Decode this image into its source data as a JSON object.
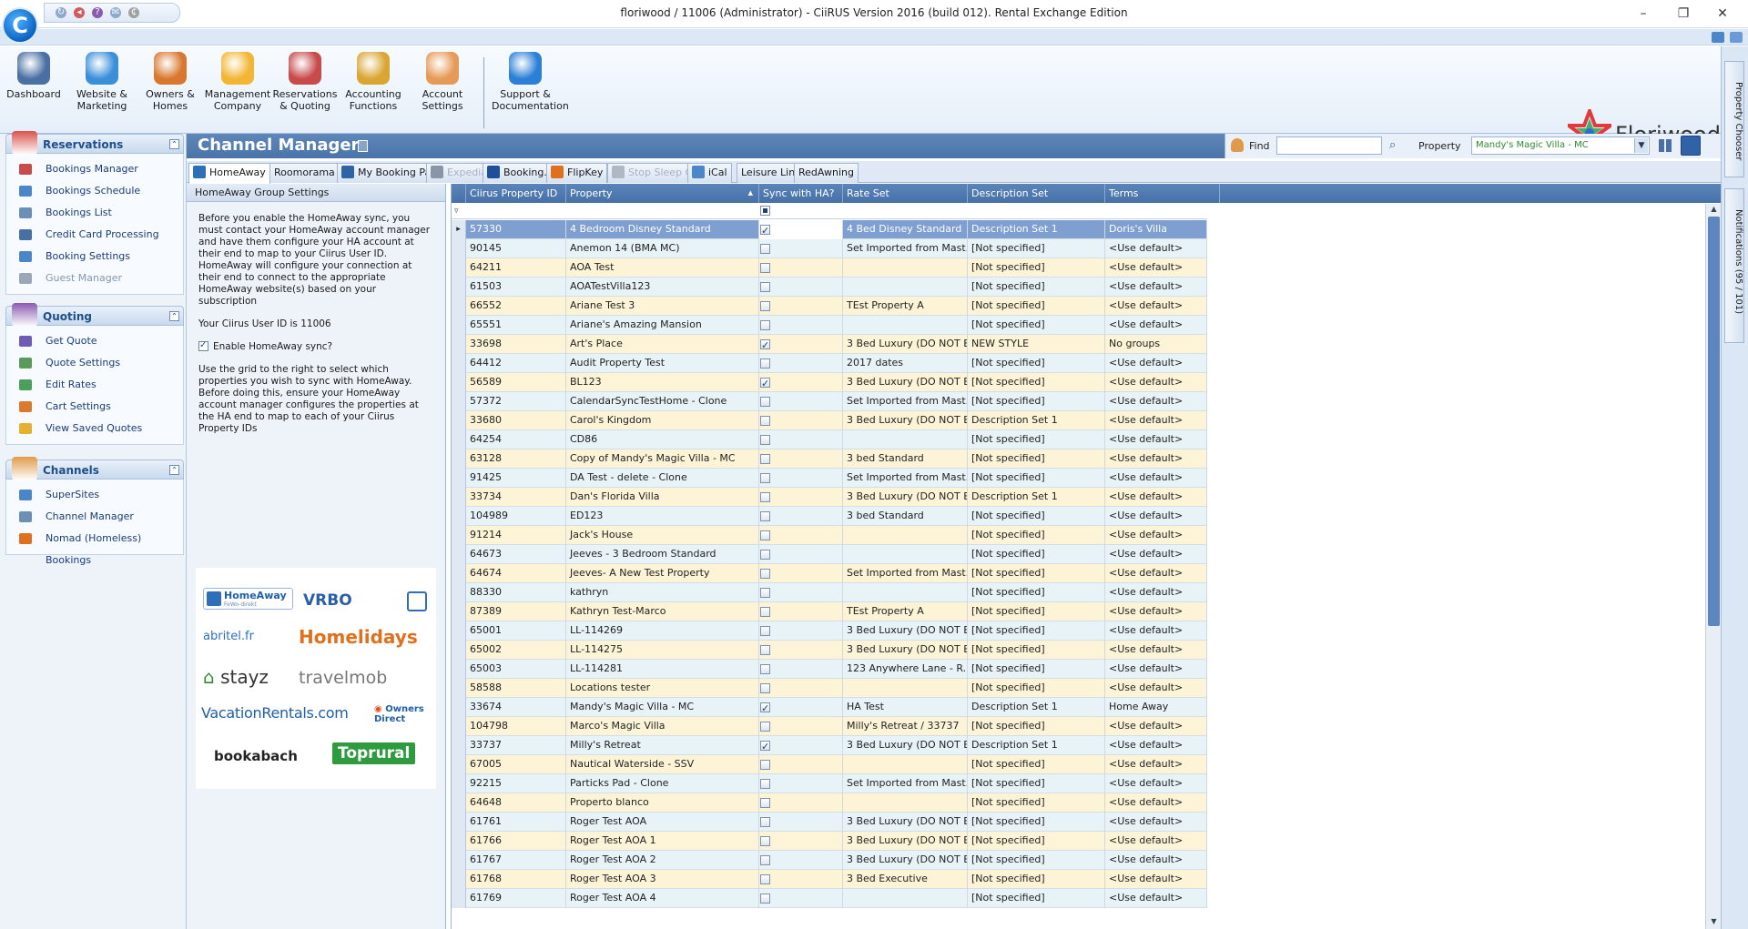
{
  "window": {
    "title": "floriwood / 11006 (Administrator) - CiiRUS Version 2016 (build 012). Rental Exchange Edition",
    "min_symbol": "–",
    "max_symbol": "❐",
    "close_symbol": "✕",
    "orb_letter": "C"
  },
  "ribbon": {
    "buttons": [
      {
        "label": "Dashboard",
        "icon": "gauge-icon",
        "color": "#4a6fa3"
      },
      {
        "label": "Website & Marketing",
        "icon": "globe-icon",
        "color": "#3b8fd9"
      },
      {
        "label": "Owners & Homes",
        "icon": "house-icon",
        "color": "#d9772e"
      },
      {
        "label": "Management Company",
        "icon": "puzzle-icon",
        "color": "#f2b634"
      },
      {
        "label": "Reservations & Quoting",
        "icon": "calendar-icon",
        "color": "#c84a4a"
      },
      {
        "label": "Accounting Functions",
        "icon": "coins-icon",
        "color": "#d9a634"
      },
      {
        "label": "Account Settings",
        "icon": "users-icon",
        "color": "#e59a57"
      },
      {
        "label": "Support & Documentation",
        "icon": "help-icon",
        "color": "#2a7fd6"
      }
    ],
    "logo_text": "Floriwood"
  },
  "nav": {
    "groups": [
      {
        "title": "Reservations",
        "items": [
          {
            "label": "Bookings Manager",
            "disabled": false
          },
          {
            "label": "Bookings Schedule",
            "disabled": false
          },
          {
            "label": "Bookings List",
            "disabled": false
          },
          {
            "label": "Credit Card Processing",
            "disabled": false
          },
          {
            "label": "Booking Settings",
            "disabled": false
          },
          {
            "label": "Guest Manager",
            "disabled": true
          }
        ]
      },
      {
        "title": "Quoting",
        "items": [
          {
            "label": "Get Quote",
            "disabled": false
          },
          {
            "label": "Quote Settings",
            "disabled": false
          },
          {
            "label": "Edit Rates",
            "disabled": false
          },
          {
            "label": "Cart Settings",
            "disabled": false
          },
          {
            "label": "View Saved Quotes",
            "disabled": false
          }
        ]
      },
      {
        "title": "Channels",
        "items": [
          {
            "label": "SuperSites",
            "disabled": false
          },
          {
            "label": "Channel Manager",
            "disabled": false
          },
          {
            "label": "Nomad (Homeless) Bookings",
            "disabled": false
          }
        ]
      }
    ]
  },
  "header": {
    "title": "Channel Manager",
    "find_label": "Find",
    "find_value": "",
    "property_label": "Property",
    "property_value": "Mandy's Magic Villa - MC"
  },
  "tabs": [
    {
      "label": "HomeAway",
      "active": true,
      "disabled": false
    },
    {
      "label": "Roomorama",
      "active": false,
      "disabled": false
    },
    {
      "label": "My Booking Pal",
      "active": false,
      "disabled": false
    },
    {
      "label": "Expedia",
      "active": false,
      "disabled": true
    },
    {
      "label": "Booking.com",
      "active": false,
      "disabled": false
    },
    {
      "label": "FlipKey",
      "active": false,
      "disabled": false
    },
    {
      "label": "Stop Sleep Go",
      "active": false,
      "disabled": true
    },
    {
      "label": "iCal",
      "active": false,
      "disabled": false
    },
    {
      "label": "Leisure Link",
      "active": false,
      "disabled": false
    },
    {
      "label": "RedAwning",
      "active": false,
      "disabled": false
    }
  ],
  "settings": {
    "header": "HomeAway Group Settings",
    "intro": "Before you enable the HomeAway sync, you must contact your HomeAway account manager and have them configure your HA account at their end to map to your Ciirus User ID. HomeAway will configure your connection at their end to connect to the appropriate HomeAway website(s) based on your subscription",
    "user_id_text": "Your Ciirus User ID is 11006",
    "enable_label": "Enable HomeAway sync?",
    "enable_checked": true,
    "instructions": "Use the grid to the right to select which properties you wish to sync with HomeAway. Before doing this, ensure your HomeAway account manager configures the properties at the HA end to map to each of your Ciirus Property IDs",
    "logos": {
      "homeaway": "HomeAway",
      "homeaway_sub": "FeWo-direkt",
      "vrbo": "VRBO",
      "abritel": "abritel.fr",
      "homelidays": "Homelidays",
      "stayz": "stayz",
      "travelmob": "travelmob",
      "vacationrentals": "VacationRentals.com",
      "ownersdirect": "Owners Direct",
      "bookabach": "bookabach",
      "toprural": "Toprural"
    }
  },
  "grid": {
    "columns": [
      "Ciirus Property ID",
      "Property",
      "Sync with HA?",
      "Rate Set",
      "Description Set",
      "Terms"
    ],
    "rows": [
      {
        "id": "57330",
        "property": "4 Bedroom Disney Standard",
        "sync": true,
        "rate": "4 Bed Disney Standard",
        "desc": "Description Set 1",
        "terms": "Doris's Villa",
        "selected": true
      },
      {
        "id": "90145",
        "property": "Anemon 14 (BMA MC)",
        "sync": false,
        "rate": "Set Imported from Mast...",
        "desc": "[Not specified]",
        "terms": "<Use default>"
      },
      {
        "id": "64211",
        "property": "AOA Test",
        "sync": false,
        "rate": "",
        "desc": "[Not specified]",
        "terms": "<Use default>"
      },
      {
        "id": "61503",
        "property": "AOATestVilla123",
        "sync": false,
        "rate": "",
        "desc": "[Not specified]",
        "terms": "<Use default>"
      },
      {
        "id": "66552",
        "property": "Ariane Test 3",
        "sync": false,
        "rate": "TEst Property A",
        "desc": "[Not specified]",
        "terms": "<Use default>"
      },
      {
        "id": "65551",
        "property": "Ariane's Amazing Mansion",
        "sync": false,
        "rate": "",
        "desc": "[Not specified]",
        "terms": "<Use default>"
      },
      {
        "id": "33698",
        "property": "Art's Place",
        "sync": true,
        "rate": "3 Bed Luxury (DO NOT E...",
        "desc": "NEW STYLE",
        "terms": "No groups"
      },
      {
        "id": "64412",
        "property": "Audit Property Test",
        "sync": false,
        "rate": "2017 dates",
        "desc": "[Not specified]",
        "terms": "<Use default>"
      },
      {
        "id": "56589",
        "property": "BL123",
        "sync": true,
        "rate": "3 Bed Luxury (DO NOT E...",
        "desc": "[Not specified]",
        "terms": "<Use default>"
      },
      {
        "id": "57372",
        "property": "CalendarSyncTestHome - Clone",
        "sync": false,
        "rate": "Set Imported from Mast...",
        "desc": "[Not specified]",
        "terms": "<Use default>"
      },
      {
        "id": "33680",
        "property": "Carol's Kingdom",
        "sync": false,
        "rate": "3 Bed Luxury (DO NOT E...",
        "desc": "Description Set 1",
        "terms": "<Use default>"
      },
      {
        "id": "64254",
        "property": "CD86",
        "sync": false,
        "rate": "",
        "desc": "[Not specified]",
        "terms": "<Use default>"
      },
      {
        "id": "63128",
        "property": "Copy of Mandy's Magic Villa - MC",
        "sync": false,
        "rate": "3 bed Standard",
        "desc": "[Not specified]",
        "terms": "<Use default>"
      },
      {
        "id": "91425",
        "property": "DA Test - delete - Clone",
        "sync": false,
        "rate": "Set Imported from Mast...",
        "desc": "[Not specified]",
        "terms": "<Use default>"
      },
      {
        "id": "33734",
        "property": "Dan's Florida Villa",
        "sync": false,
        "rate": "3 Bed Luxury (DO NOT E...",
        "desc": "Description Set 1",
        "terms": "<Use default>"
      },
      {
        "id": "104989",
        "property": "ED123",
        "sync": false,
        "rate": "3 bed Standard",
        "desc": "[Not specified]",
        "terms": "<Use default>"
      },
      {
        "id": "91214",
        "property": "Jack's House",
        "sync": false,
        "rate": "",
        "desc": "[Not specified]",
        "terms": "<Use default>"
      },
      {
        "id": "64673",
        "property": "Jeeves - 3 Bedroom Standard",
        "sync": false,
        "rate": "",
        "desc": "[Not specified]",
        "terms": "<Use default>"
      },
      {
        "id": "64674",
        "property": "Jeeves- A New Test Property",
        "sync": false,
        "rate": "Set Imported from Mast...",
        "desc": "[Not specified]",
        "terms": "<Use default>"
      },
      {
        "id": "88330",
        "property": "kathryn",
        "sync": false,
        "rate": "",
        "desc": "[Not specified]",
        "terms": "<Use default>"
      },
      {
        "id": "87389",
        "property": "Kathryn Test-Marco",
        "sync": false,
        "rate": "TEst Property A",
        "desc": "[Not specified]",
        "terms": "<Use default>"
      },
      {
        "id": "65001",
        "property": "LL-114269",
        "sync": false,
        "rate": "3 Bed Luxury (DO NOT E...",
        "desc": "[Not specified]",
        "terms": "<Use default>"
      },
      {
        "id": "65002",
        "property": "LL-114275",
        "sync": false,
        "rate": "3 Bed Luxury (DO NOT E...",
        "desc": "[Not specified]",
        "terms": "<Use default>"
      },
      {
        "id": "65003",
        "property": "LL-114281",
        "sync": false,
        "rate": "123 Anywhere Lane - R...",
        "desc": "[Not specified]",
        "terms": "<Use default>"
      },
      {
        "id": "58588",
        "property": "Locations tester",
        "sync": false,
        "rate": "",
        "desc": "[Not specified]",
        "terms": "<Use default>"
      },
      {
        "id": "33674",
        "property": "Mandy's Magic Villa - MC",
        "sync": true,
        "rate": "HA Test",
        "desc": "Description Set 1",
        "terms": "Home Away"
      },
      {
        "id": "104798",
        "property": "Marco's Magic Villa",
        "sync": false,
        "rate": "Milly's Retreat / 33737",
        "desc": "[Not specified]",
        "terms": "<Use default>"
      },
      {
        "id": "33737",
        "property": "Milly's Retreat",
        "sync": true,
        "rate": "3 Bed Luxury (DO NOT E...",
        "desc": "Description Set 1",
        "terms": "<Use default>"
      },
      {
        "id": "67005",
        "property": "Nautical Waterside - SSV",
        "sync": false,
        "rate": "",
        "desc": "[Not specified]",
        "terms": "<Use default>"
      },
      {
        "id": "92215",
        "property": "Particks Pad - Clone",
        "sync": false,
        "rate": "Set Imported from Mast...",
        "desc": "[Not specified]",
        "terms": "<Use default>"
      },
      {
        "id": "64648",
        "property": "Properto blanco",
        "sync": false,
        "rate": "",
        "desc": "[Not specified]",
        "terms": "<Use default>"
      },
      {
        "id": "61761",
        "property": "Roger Test AOA",
        "sync": false,
        "rate": "3 Bed Luxury (DO NOT E...",
        "desc": "[Not specified]",
        "terms": "<Use default>"
      },
      {
        "id": "61766",
        "property": "Roger Test AOA 1",
        "sync": false,
        "rate": "3 Bed Luxury (DO NOT E...",
        "desc": "[Not specified]",
        "terms": "<Use default>"
      },
      {
        "id": "61767",
        "property": "Roger Test AOA 2",
        "sync": false,
        "rate": "3 Bed Luxury (DO NOT E...",
        "desc": "[Not specified]",
        "terms": "<Use default>"
      },
      {
        "id": "61768",
        "property": "Roger Test AOA 3",
        "sync": false,
        "rate": "3 Bed Executive",
        "desc": "[Not specified]",
        "terms": "<Use default>"
      },
      {
        "id": "61769",
        "property": "Roger Test AOA 4",
        "sync": false,
        "rate": "",
        "desc": "[Not specified]",
        "terms": "<Use default>"
      }
    ]
  },
  "right_tabs": {
    "property_chooser": "Property Chooser",
    "notifications": "Notifications (95 / 101)"
  },
  "colors": {
    "row_alt_a": "#e8f3f8",
    "row_alt_b": "#fdf4d7",
    "header_blue": "#4a74aa",
    "selected_row": "#7f9fd1"
  }
}
